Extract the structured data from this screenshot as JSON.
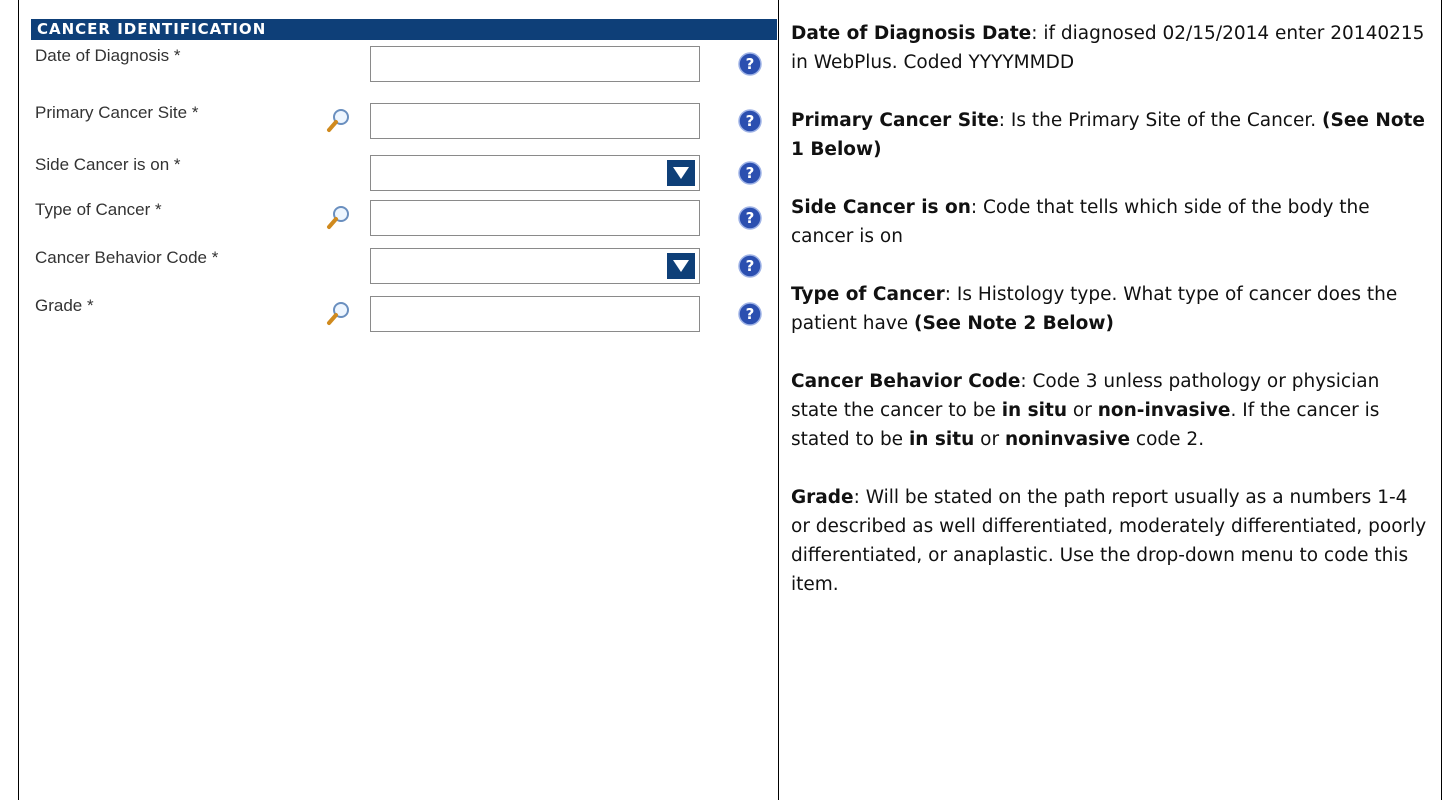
{
  "section": {
    "title": "CANCER IDENTIFICATION"
  },
  "fields": [
    {
      "label": "Date of Diagnosis *",
      "kind": "text",
      "value": ""
    },
    {
      "label": "Primary Cancer Site *",
      "kind": "lookup",
      "value": ""
    },
    {
      "label": "Side Cancer is on *",
      "kind": "select",
      "value": ""
    },
    {
      "label": "Type of Cancer *",
      "kind": "lookup",
      "value": ""
    },
    {
      "label": "Cancer Behavior Code *",
      "kind": "select",
      "value": ""
    },
    {
      "label": "Grade *",
      "kind": "lookup",
      "value": ""
    }
  ],
  "icons": {
    "lookup": "magnifier-icon",
    "help": "help-icon",
    "dropdown": "dropdown-arrow-icon"
  },
  "colors": {
    "header_bg": "#0e3f78",
    "accent": "#0e3f78"
  },
  "notes": {
    "diagnosis": {
      "term": "Date of Diagnosis Date",
      "text": ": if diagnosed 02/15/2014 enter 20140215 in WebPlus.  Coded YYYYMMDD"
    },
    "site": {
      "term": "Primary Cancer Site",
      "text": ": Is the Primary Site of the Cancer. ",
      "note": "(See Note 1 Below)"
    },
    "side": {
      "term": "Side Cancer is on",
      "text": ":  Code that tells which side of the body the cancer is on"
    },
    "type": {
      "term": "Type of Cancer",
      "text": ": Is Histology type. What type of cancer does the patient have ",
      "note": "(See Note 2 Below)"
    },
    "behavior": {
      "term": "Cancer Behavior Code",
      "t1": ": Code 3 unless pathology or physician state the cancer to be ",
      "b1": "in situ",
      "t2": " or ",
      "b2": "non-invasive",
      "t3": ". If the cancer is stated to be ",
      "b3": "in situ",
      "t4": " or ",
      "b4": "noninvasive",
      "t5": " code 2."
    },
    "grade": {
      "term": "Grade",
      "text": ": Will be stated on the path report usually as a numbers 1-4 or described as well differentiated, moderately differentiated, poorly differentiated, or anaplastic.  Use the drop-down menu to code this item."
    }
  }
}
